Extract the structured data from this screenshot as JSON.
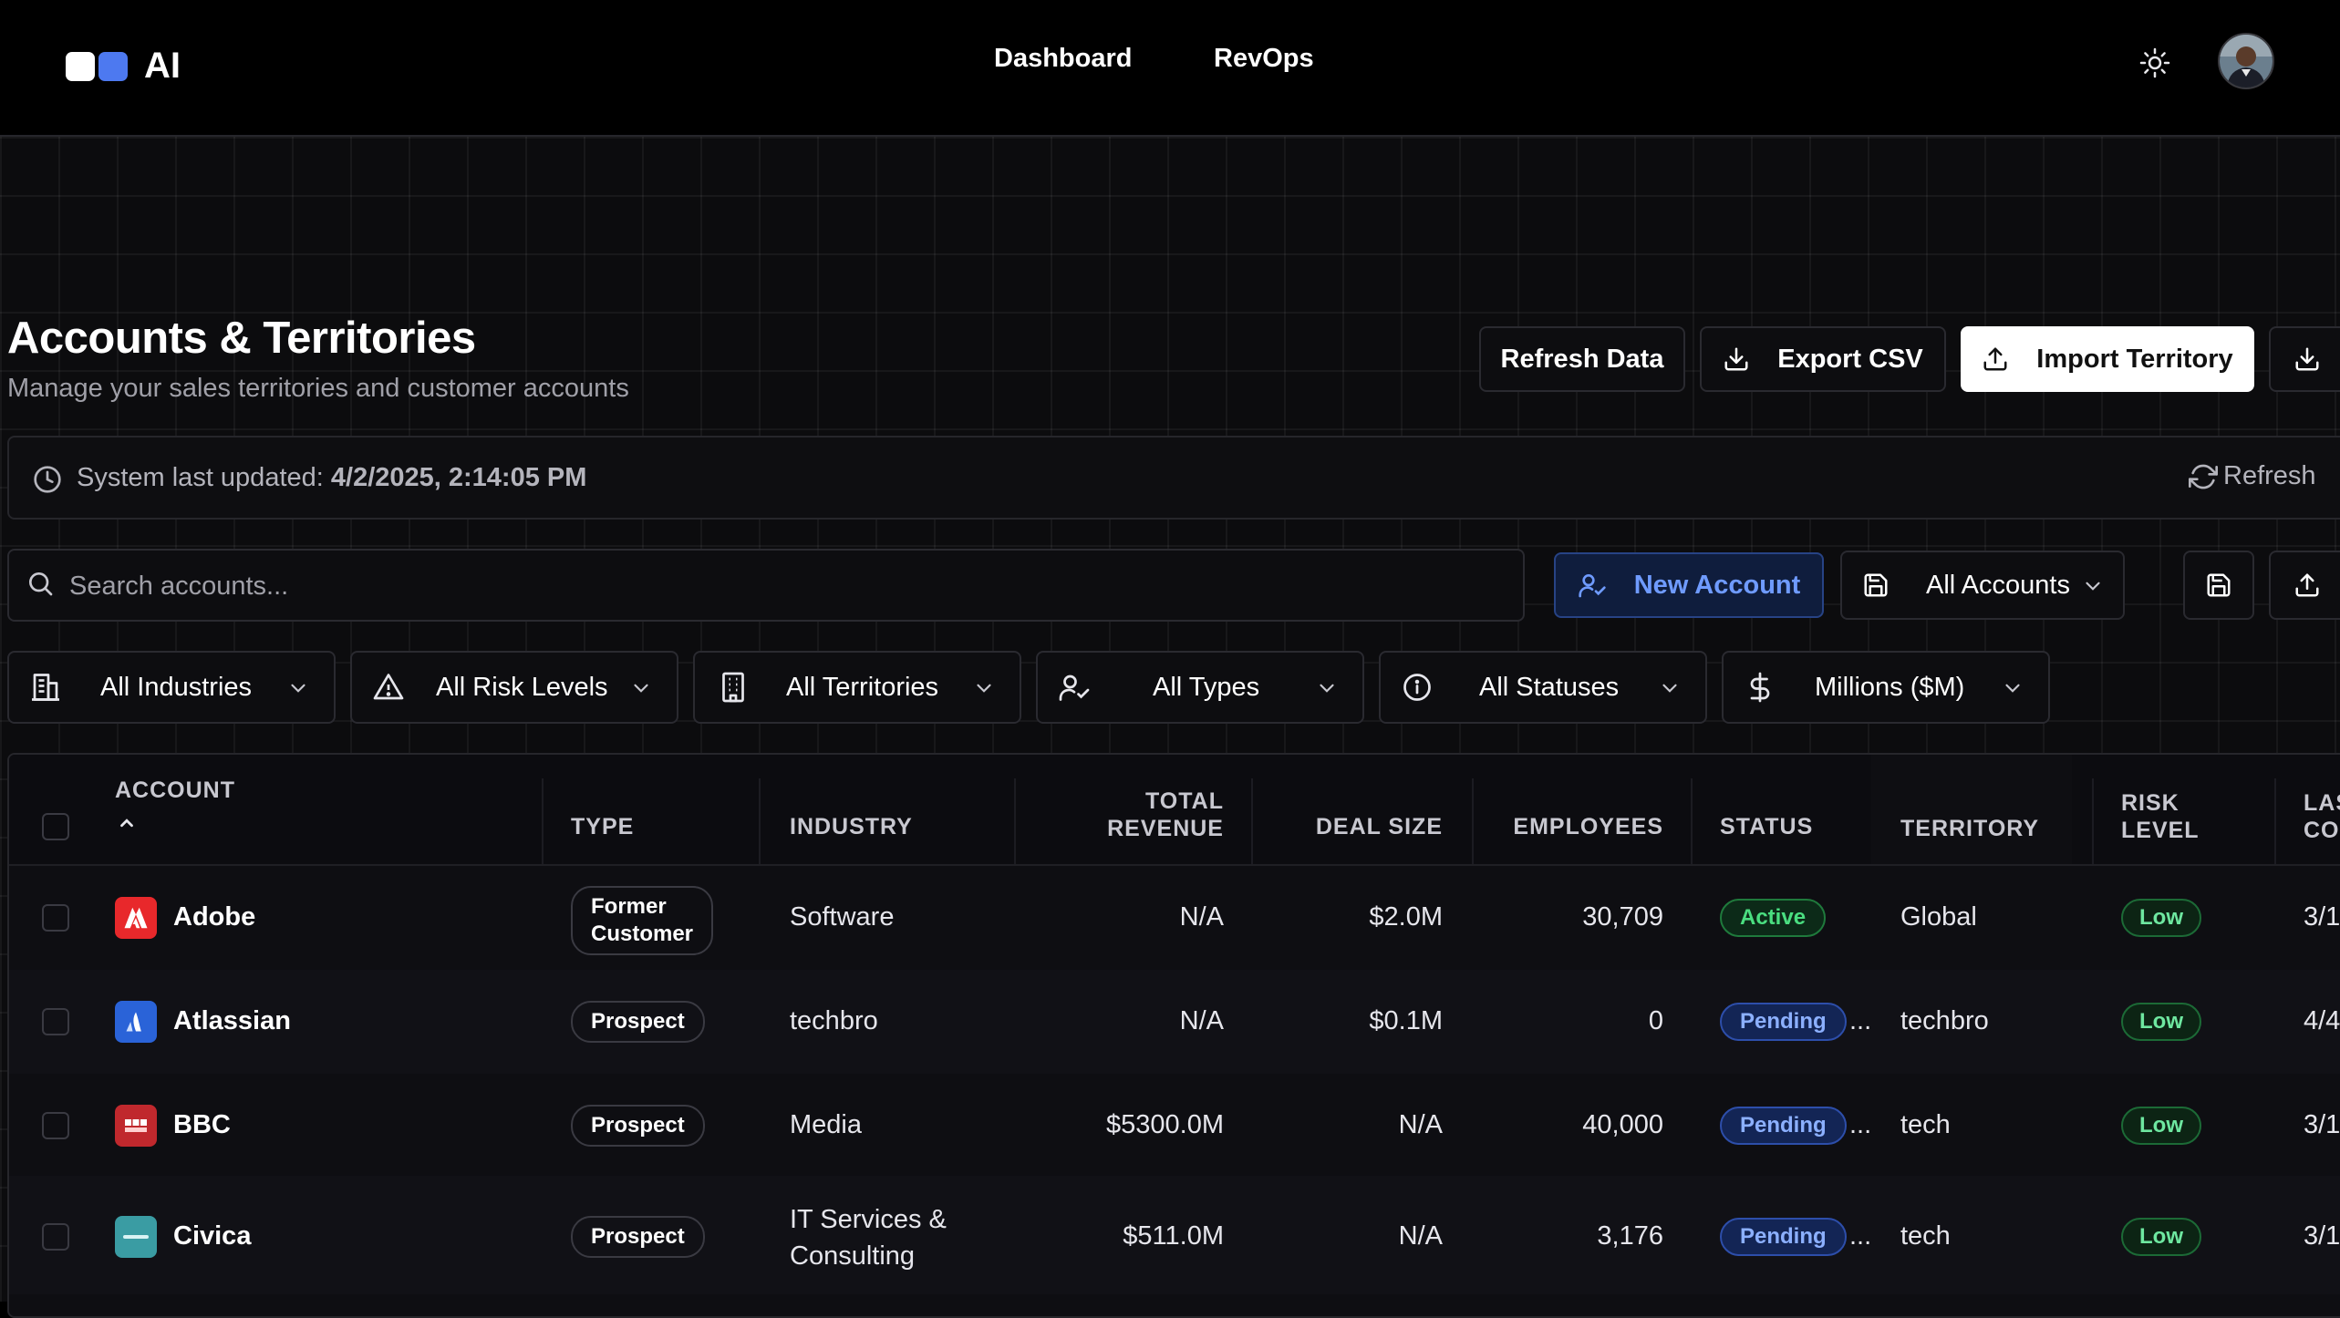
{
  "app": {
    "logo_text": "AI"
  },
  "nav": {
    "dashboard": "Dashboard",
    "revops": "RevOps"
  },
  "page": {
    "title": "Accounts & Territories",
    "subtitle": "Manage your sales territories and customer accounts"
  },
  "actions": {
    "refresh_data": "Refresh Data",
    "export_csv": "Export CSV",
    "import_territory": "Import Territory"
  },
  "status": {
    "label": "System last updated:",
    "timestamp": "4/2/2025, 2:14:05 PM",
    "refresh": "Refresh"
  },
  "search": {
    "placeholder": "Search accounts..."
  },
  "toolbar": {
    "new_account": "New Account",
    "view_select": "All Accounts"
  },
  "filters": {
    "industries": "All Industries",
    "risk_levels": "All Risk Levels",
    "territories": "All Territories",
    "types": "All Types",
    "statuses": "All Statuses",
    "units": "Millions ($M)"
  },
  "table": {
    "headers": {
      "account": "ACCOUNT",
      "type": "TYPE",
      "industry": "INDUSTRY",
      "total_revenue_1": "TOTAL",
      "total_revenue_2": "REVENUE",
      "deal_size": "DEAL SIZE",
      "employees": "EMPLOYEES",
      "status": "STATUS",
      "territory": "TERRITORY",
      "risk_1": "RISK",
      "risk_2": "LEVEL",
      "last_1": "LAS",
      "last_2": "CO"
    },
    "rows": [
      {
        "name": "Adobe",
        "icon": "adobe-logo",
        "type": "Former",
        "type2": "Customer",
        "industry": "Software",
        "industry2": "",
        "revenue": "N/A",
        "deal": "$2.0M",
        "employees": "30,709",
        "status": "Active",
        "territory": "Global",
        "risk": "Low",
        "last": "3/1"
      },
      {
        "name": "Atlassian",
        "icon": "atlassian-logo",
        "type": "Prospect",
        "industry": "techbro",
        "industry2": "",
        "revenue": "N/A",
        "deal": "$0.1M",
        "employees": "0",
        "status": "Pending",
        "territory": "techbro",
        "risk": "Low",
        "last": "4/4"
      },
      {
        "name": "BBC",
        "icon": "bbc-logo",
        "type": "Prospect",
        "industry": "Media",
        "industry2": "",
        "revenue": "$5300.0M",
        "deal": "N/A",
        "employees": "40,000",
        "status": "Pending",
        "territory": "tech",
        "risk": "Low",
        "last": "3/1"
      },
      {
        "name": "Civica",
        "icon": "civica-logo",
        "type": "Prospect",
        "industry": "IT Services &",
        "industry2": "Consulting",
        "revenue": "$511.0M",
        "deal": "N/A",
        "employees": "3,176",
        "status": "Pending",
        "territory": "tech",
        "risk": "Low",
        "last": "3/1"
      }
    ],
    "ellipsis": "..."
  },
  "icons": {
    "theme": "sun-icon",
    "download": "download-icon",
    "upload": "upload-icon",
    "clock": "clock-icon",
    "refresh": "refresh-icon",
    "search": "search-icon",
    "user_add": "user-plus-icon",
    "save": "save-icon",
    "chevron": "chevron-down-icon",
    "industry": "factory-icon",
    "risk": "warning-triangle-icon",
    "territory": "building-icon",
    "type": "user-check-icon",
    "status": "info-circle-icon",
    "currency": "dollar-icon",
    "sort": "sort-up-icon"
  },
  "colors": {
    "accent_blue": "#4d79f0",
    "active_green": "#4ade80",
    "pending_blue": "#8cb0ff",
    "adobe_red": "#e8282b",
    "atlassian_blue": "#2a63d8",
    "bbc_red": "#c0282d",
    "civica_teal": "#3a9ca3"
  }
}
